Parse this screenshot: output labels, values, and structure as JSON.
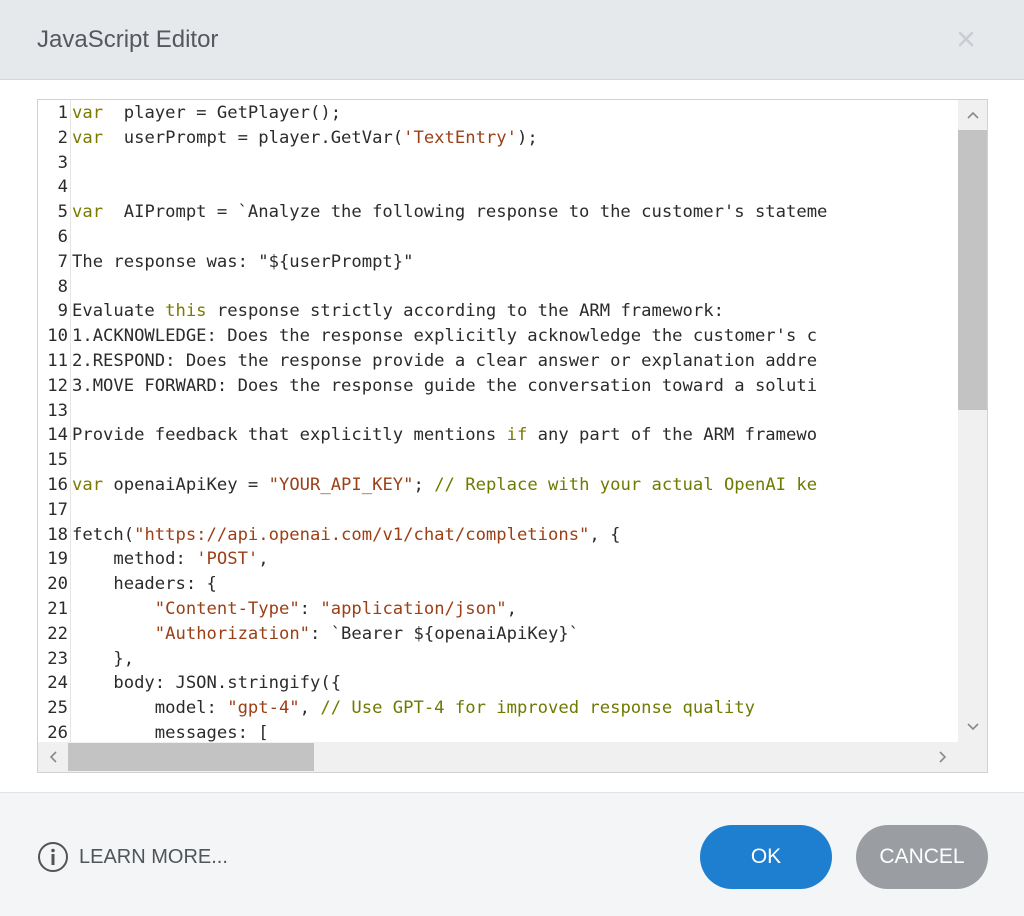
{
  "window": {
    "title": "JavaScript Editor"
  },
  "editor": {
    "lines": [
      {
        "n": "1",
        "t": [
          [
            "kw",
            "var"
          ],
          [
            "",
            "  player = GetPlayer();"
          ]
        ]
      },
      {
        "n": "2",
        "t": [
          [
            "kw",
            "var"
          ],
          [
            "",
            "  userPrompt = player.GetVar("
          ],
          [
            "str",
            "'TextEntry'"
          ],
          [
            "",
            ");"
          ]
        ]
      },
      {
        "n": "3",
        "t": []
      },
      {
        "n": "4",
        "t": []
      },
      {
        "n": "5",
        "t": [
          [
            "kw",
            "var"
          ],
          [
            "",
            "  AIPrompt = `Analyze the following response to the customer's stateme"
          ]
        ]
      },
      {
        "n": "6",
        "t": []
      },
      {
        "n": "7",
        "t": [
          [
            "",
            "The response was: \"${userPrompt}\""
          ]
        ]
      },
      {
        "n": "8",
        "t": []
      },
      {
        "n": "9",
        "t": [
          [
            "",
            "Evaluate "
          ],
          [
            "kw",
            "this"
          ],
          [
            "",
            " response strictly according to the ARM framework:"
          ]
        ]
      },
      {
        "n": "10",
        "t": [
          [
            "",
            "1.ACKNOWLEDGE: Does the response explicitly acknowledge the customer's c"
          ]
        ]
      },
      {
        "n": "11",
        "t": [
          [
            "",
            "2.RESPOND: Does the response provide a clear answer or explanation addre"
          ]
        ]
      },
      {
        "n": "12",
        "t": [
          [
            "",
            "3.MOVE FORWARD: Does the response guide the conversation toward a soluti"
          ]
        ]
      },
      {
        "n": "13",
        "t": []
      },
      {
        "n": "14",
        "t": [
          [
            "",
            "Provide feedback that explicitly mentions "
          ],
          [
            "kw",
            "if"
          ],
          [
            "",
            " any part of the ARM framewo"
          ]
        ]
      },
      {
        "n": "15",
        "t": []
      },
      {
        "n": "16",
        "t": [
          [
            "kw",
            "var"
          ],
          [
            "",
            " openaiApiKey = "
          ],
          [
            "str",
            "\"YOUR_API_KEY\""
          ],
          [
            "",
            "; "
          ],
          [
            "cm",
            "// Replace with your actual OpenAI ke"
          ]
        ]
      },
      {
        "n": "17",
        "t": []
      },
      {
        "n": "18",
        "t": [
          [
            "",
            "fetch("
          ],
          [
            "str",
            "\"https://api.openai.com/v1/chat/completions\""
          ],
          [
            "",
            ", {"
          ]
        ]
      },
      {
        "n": "19",
        "t": [
          [
            "",
            "    method: "
          ],
          [
            "str",
            "'POST'"
          ],
          [
            "",
            ","
          ]
        ]
      },
      {
        "n": "20",
        "t": [
          [
            "",
            "    headers: {"
          ]
        ]
      },
      {
        "n": "21",
        "t": [
          [
            "",
            "        "
          ],
          [
            "str",
            "\"Content-Type\""
          ],
          [
            "",
            ": "
          ],
          [
            "str",
            "\"application/json\""
          ],
          [
            "",
            ","
          ]
        ]
      },
      {
        "n": "22",
        "t": [
          [
            "",
            "        "
          ],
          [
            "str",
            "\"Authorization\""
          ],
          [
            "",
            ": `Bearer ${openaiApiKey}`"
          ]
        ]
      },
      {
        "n": "23",
        "t": [
          [
            "",
            "    },"
          ]
        ]
      },
      {
        "n": "24",
        "t": [
          [
            "",
            "    body: JSON.stringify({"
          ]
        ]
      },
      {
        "n": "25",
        "t": [
          [
            "",
            "        model: "
          ],
          [
            "str",
            "\"gpt-4\""
          ],
          [
            "",
            ", "
          ],
          [
            "cm",
            "// Use GPT-4 for improved response quality"
          ]
        ]
      },
      {
        "n": "26",
        "t": [
          [
            "",
            "        messages: ["
          ]
        ]
      }
    ]
  },
  "footer": {
    "learn_more": "LEARN MORE...",
    "ok_label": "OK",
    "cancel_label": "CANCEL"
  },
  "colors": {
    "ok": "#1e7fd1",
    "cancel": "#9a9ea3",
    "keyword": "#7a7a00",
    "string": "#9b3f16",
    "comment": "#6f7a00"
  }
}
